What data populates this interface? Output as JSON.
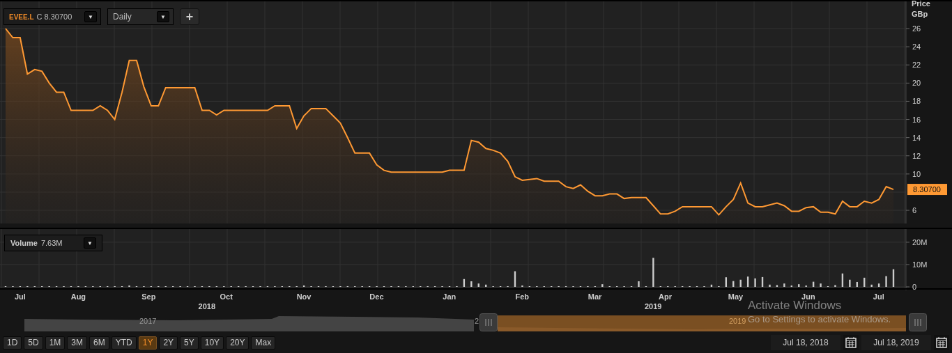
{
  "toolbar": {
    "quote": "C 8.30700",
    "symbol_menu": "▼",
    "interval": "Daily",
    "interval_menu": "▼",
    "add": "+"
  },
  "price_chart": {
    "axis_title": "Price",
    "axis_unit": "GBp",
    "last_price": "8.30700",
    "chart_data": {
      "type": "area",
      "grid": true,
      "ylim": [
        4.55,
        28.99
      ],
      "yticks": [
        6,
        10,
        12,
        14,
        16,
        18,
        20,
        22,
        24,
        26
      ],
      "categories": [
        null,
        null,
        null,
        null,
        null,
        null,
        null,
        null,
        null,
        null,
        null,
        null,
        null,
        null,
        null,
        null,
        null,
        null,
        null,
        null,
        null,
        null,
        null,
        null,
        null,
        null,
        null,
        null,
        null,
        null,
        null,
        null,
        null,
        null,
        null,
        null,
        null,
        null,
        null,
        null,
        null,
        null,
        null,
        null,
        null,
        null,
        null,
        null,
        null,
        null,
        null,
        null,
        null,
        null,
        null,
        null,
        null,
        null,
        null,
        null,
        null,
        null,
        null,
        null,
        null,
        null,
        null,
        null,
        null,
        null,
        null,
        null,
        null,
        null,
        null,
        null,
        null,
        null,
        null,
        null,
        null,
        null,
        null,
        null,
        null,
        null,
        null,
        null,
        null,
        null,
        null,
        null,
        null,
        null,
        null,
        null,
        null,
        null,
        null,
        null,
        null,
        null,
        null,
        null,
        null,
        null,
        null,
        null,
        null,
        null,
        null,
        null,
        null,
        null,
        null,
        null,
        null,
        null,
        null,
        null,
        null,
        null,
        null
      ],
      "series": [
        {
          "name": "EVEE.L",
          "color": "#ff9933",
          "values": [
            26,
            25,
            25,
            21,
            21.5,
            21.3,
            20,
            19,
            19,
            17,
            17,
            17,
            17,
            17.5,
            17,
            16,
            19,
            22.5,
            22.5,
            19.6,
            17.5,
            17.5,
            19.5,
            19.5,
            19.5,
            19.5,
            19.5,
            17,
            17,
            16.5,
            17,
            17,
            17,
            17,
            17,
            17,
            17,
            17.5,
            17.5,
            17.5,
            15,
            16.4,
            17.2,
            17.2,
            17.2,
            16.4,
            15.6,
            14,
            12.3,
            12.3,
            12.3,
            11,
            10.4,
            10.2,
            10.2,
            10.2,
            10.2,
            10.2,
            10.2,
            10.2,
            10.2,
            10.4,
            10.4,
            10.4,
            13.7,
            13.5,
            12.8,
            12.6,
            12.3,
            11.4,
            9.7,
            9.3,
            9.4,
            9.5,
            9.2,
            9.2,
            9.2,
            8.6,
            8.4,
            8.8,
            8.1,
            7.6,
            7.6,
            7.8,
            7.8,
            7.3,
            7.4,
            7.4,
            7.4,
            6.5,
            5.6,
            5.6,
            5.9,
            6.4,
            6.4,
            6.4,
            6.4,
            6.4,
            5.5,
            6.4,
            7.2,
            9,
            6.8,
            6.4,
            6.4,
            6.6,
            6.8,
            6.5,
            5.9,
            5.9,
            6.3,
            6.4,
            5.8,
            5.8,
            5.6,
            7,
            6.4,
            6.4,
            7,
            6.8,
            7.2,
            8.6,
            8.3
          ]
        }
      ]
    }
  },
  "volume_chart": {
    "value": "7.63M",
    "menu": "▼",
    "chart_data": {
      "type": "bar",
      "grid": true,
      "ylim": [
        0,
        25.9
      ],
      "yticks": [
        {
          "value": 0,
          "label": "0"
        },
        {
          "value": 10,
          "label": "10M"
        },
        {
          "value": 20,
          "label": "20M"
        }
      ],
      "categories": [
        null,
        null,
        null,
        null,
        null,
        null,
        null,
        null,
        null,
        null,
        null,
        null,
        null,
        null,
        null,
        null,
        null,
        null,
        null,
        null,
        null,
        null,
        null,
        null,
        null,
        null,
        null,
        null,
        null,
        null,
        null,
        null,
        null,
        null,
        null,
        null,
        null,
        null,
        null,
        null,
        null,
        null,
        null,
        null,
        null,
        null,
        null,
        null,
        null,
        null,
        null,
        null,
        null,
        null,
        null,
        null,
        null,
        null,
        null,
        null,
        null,
        null,
        null,
        null,
        null,
        null,
        null,
        null,
        null,
        null,
        null,
        null,
        null,
        null,
        null,
        null,
        null,
        null,
        null,
        null,
        null,
        null,
        null,
        null,
        null,
        null,
        null,
        null,
        null,
        null,
        null,
        null,
        null,
        null,
        null,
        null,
        null,
        null,
        null,
        null,
        null,
        null,
        null,
        null,
        null,
        null,
        null,
        null,
        null,
        null,
        null,
        null,
        null,
        null,
        null,
        null,
        null,
        null,
        null,
        null,
        null,
        null,
        null
      ],
      "series": [
        {
          "name": "Volume",
          "color": "#cccccc",
          "values": [
            0.3,
            0.3,
            0.3,
            0.3,
            0.3,
            0.3,
            0.3,
            0.3,
            0.3,
            0.3,
            0.3,
            0.3,
            0.3,
            0.3,
            0.3,
            0.3,
            0.3,
            0.6,
            0.3,
            0.3,
            0.3,
            0.3,
            0.3,
            0.3,
            0.3,
            0.3,
            0.3,
            0.3,
            0.3,
            0.3,
            0.3,
            0.3,
            0.3,
            0.3,
            0.3,
            0.3,
            0.3,
            0.3,
            0.3,
            0.3,
            0.3,
            0.6,
            0.3,
            0.3,
            0.3,
            0.3,
            0.3,
            0.3,
            0.3,
            0.3,
            0.3,
            0.3,
            0.3,
            0.3,
            0.3,
            0.3,
            0.3,
            0.3,
            0.3,
            0.3,
            0.3,
            0.3,
            0.3,
            3.5,
            2.5,
            1.5,
            1,
            0.3,
            0.3,
            0.3,
            7,
            0.6,
            0.3,
            0.3,
            0.3,
            0.3,
            0.3,
            0.3,
            0.3,
            0.3,
            0.3,
            0.3,
            1.2,
            0.3,
            0.3,
            0.3,
            0.3,
            2.5,
            0.3,
            13,
            0.3,
            0.3,
            0.3,
            0.3,
            0.3,
            0.3,
            0.3,
            1,
            0.3,
            4.3,
            2.6,
            3.2,
            4.6,
            3.8,
            4.4,
            1,
            0.8,
            1.5,
            0.6,
            1.2,
            0.6,
            2.3,
            1.5,
            0.3,
            0.8,
            6,
            3.2,
            2.2,
            4.1,
            1,
            1.5,
            4.8,
            7.9
          ]
        }
      ]
    }
  },
  "time_axis": {
    "months": [
      "Jul",
      "Aug",
      "Sep",
      "Oct",
      "Nov",
      "Dec",
      "Jan",
      "Feb",
      "Mar",
      "Apr",
      "May",
      "Jun",
      "Jul"
    ],
    "years": [
      "2018",
      "2019"
    ]
  },
  "navigator": {
    "labels": [
      "2017",
      "2",
      "2019"
    ]
  },
  "range_buttons": [
    {
      "label": "1D",
      "selected": false
    },
    {
      "label": "5D",
      "selected": false
    },
    {
      "label": "1M",
      "selected": false
    },
    {
      "label": "3M",
      "selected": false
    },
    {
      "label": "6M",
      "selected": false
    },
    {
      "label": "YTD",
      "selected": false
    },
    {
      "label": "1Y",
      "selected": true
    },
    {
      "label": "2Y",
      "selected": false
    },
    {
      "label": "5Y",
      "selected": false
    },
    {
      "label": "10Y",
      "selected": false
    },
    {
      "label": "20Y",
      "selected": false
    },
    {
      "label": "Max",
      "selected": false
    }
  ],
  "date_range": {
    "from": "Jul 18, 2018",
    "to": "Jul 18, 2019"
  },
  "os_overlay": {
    "title": "Activate Windows",
    "subtitle": "Go to Settings to activate Windows."
  }
}
